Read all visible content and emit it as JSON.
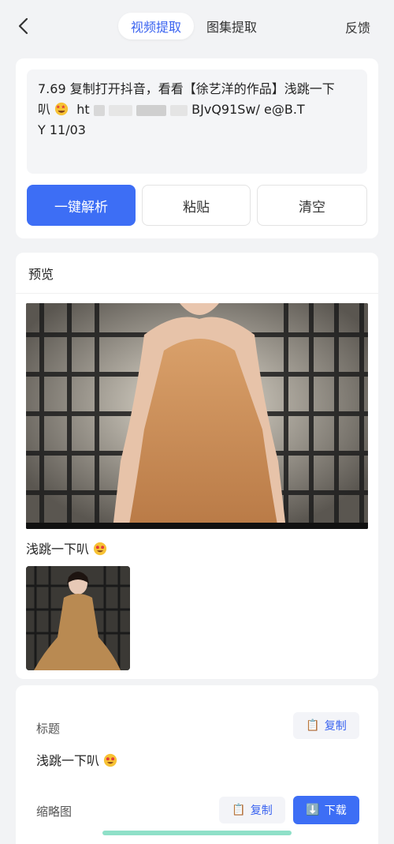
{
  "header": {
    "tabs": [
      {
        "label": "视频提取",
        "active": true
      },
      {
        "label": "图集提取",
        "active": false
      }
    ],
    "feedback_label": "反馈"
  },
  "input": {
    "text_line1": "7.69 复制打开抖音，看看【徐艺洋的作品】浅跳一下",
    "text_line2_a": "叭",
    "text_line2_b": "ht",
    "text_line2_c": "BJvQ91Sw/ e@B.T",
    "text_line3": "Y 11/03"
  },
  "actions": {
    "parse_label": "一键解析",
    "paste_label": "粘贴",
    "clear_label": "清空"
  },
  "preview": {
    "heading": "预览",
    "video_title": "浅跳一下叭"
  },
  "detail": {
    "title_label": "标题",
    "title_value": "浅跳一下叭",
    "copy_label": "复制",
    "thumb_label": "缩略图",
    "thumb_copy_label": "复制",
    "download_label": "下载"
  },
  "colors": {
    "accent": "#3d6ef5",
    "background": "#f2f3f5"
  }
}
